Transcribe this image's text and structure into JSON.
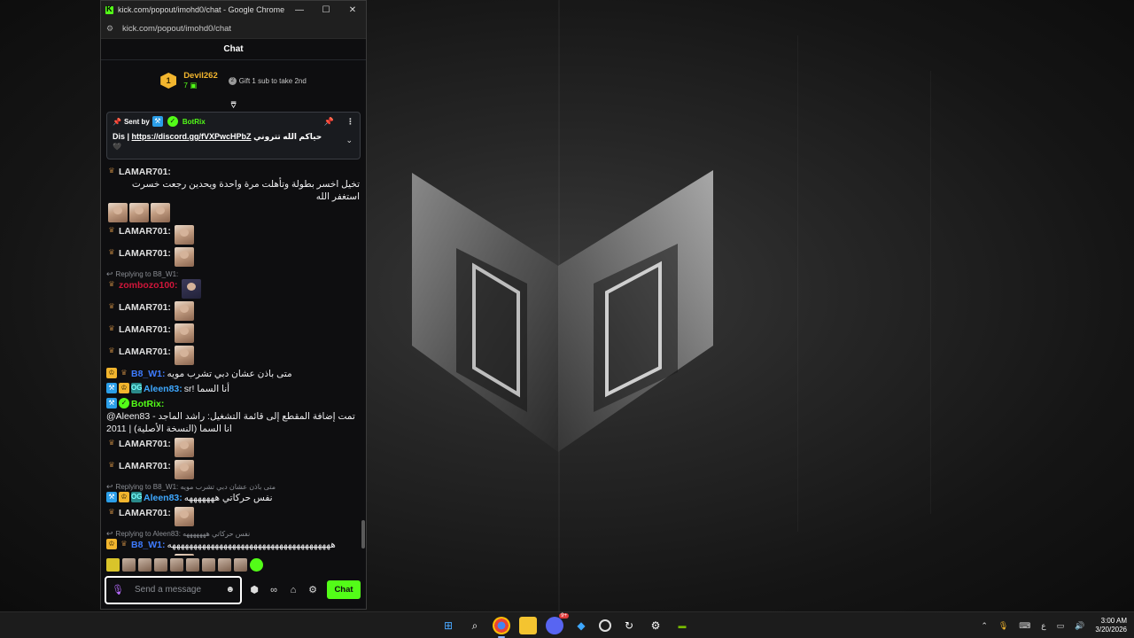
{
  "browser": {
    "title": "kick.com/popout/imohd0/chat - Google Chrome",
    "url": "kick.com/popout/imohd0/chat",
    "minimize": "—",
    "maximize": "☐",
    "close": "✕"
  },
  "chat": {
    "header": "Chat",
    "leaderboard": {
      "rank": "1",
      "username": "Devil262",
      "count": "7",
      "gift_text": "Gift 1 sub to take 2nd",
      "toggle": "⩢"
    },
    "pinned": {
      "sent_by_label": "Sent by",
      "sender": "BotRix",
      "message_prefix": "Dis |",
      "message_link": "https://discord.gg/fVXPwcHPbZ",
      "message_suffix": "حياكم الله تتروني",
      "message_line2": "🖤"
    },
    "messages": [
      {
        "type": "msg",
        "user": "LAMAR701",
        "style": "lamar",
        "badges": [
          "tier"
        ],
        "text": "تخيل اخسر بطولة وتأهلت مرة واحدة ويحدين رجعت خسرت استغفر الله",
        "emotes": 3
      },
      {
        "type": "msg",
        "user": "LAMAR701",
        "style": "lamar",
        "badges": [
          "tier"
        ],
        "text": "",
        "emotes": 1
      },
      {
        "type": "msg",
        "user": "LAMAR701",
        "style": "lamar",
        "badges": [
          "tier"
        ],
        "text": "",
        "emotes": 1
      },
      {
        "type": "reply",
        "text": "Replying to B8_W1:"
      },
      {
        "type": "msg",
        "user": "zombozo100",
        "style": "zombozo",
        "badges": [
          "tier"
        ],
        "text": "",
        "emotes": 1,
        "dark": true
      },
      {
        "type": "msg",
        "user": "LAMAR701",
        "style": "lamar",
        "badges": [
          "tier"
        ],
        "text": "",
        "emotes": 1
      },
      {
        "type": "msg",
        "user": "LAMAR701",
        "style": "lamar",
        "badges": [
          "tier"
        ],
        "text": "",
        "emotes": 1
      },
      {
        "type": "msg",
        "user": "LAMAR701",
        "style": "lamar",
        "badges": [
          "tier"
        ],
        "text": "",
        "emotes": 1
      },
      {
        "type": "msg",
        "user": "B8_W1",
        "style": "b8",
        "badges": [
          "crown",
          "tier"
        ],
        "text": "متى باذن عشان دبي تشرب مويه",
        "emotes": 0
      },
      {
        "type": "msg",
        "user": "Aleen83",
        "style": "aleen",
        "badges": [
          "mod",
          "crown",
          "og"
        ],
        "text": "أنا السما !sr",
        "emotes": 0
      },
      {
        "type": "msg",
        "user": "BotRix",
        "style": "botrix",
        "badges": [
          "mod",
          "verified"
        ],
        "text": "@Aleen83 تمت إضافة المقطع إلى قائمة التشغيل: راشد الماجد - انا السما (النسخة الأصلية) | 2011",
        "emotes": 0
      },
      {
        "type": "msg",
        "user": "LAMAR701",
        "style": "lamar",
        "badges": [
          "tier"
        ],
        "text": "",
        "emotes": 1
      },
      {
        "type": "msg",
        "user": "LAMAR701",
        "style": "lamar",
        "badges": [
          "tier"
        ],
        "text": "",
        "emotes": 1
      },
      {
        "type": "reply",
        "text": "Replying to B8_W1: متى باذن عشان دبي تشرب مويه"
      },
      {
        "type": "msg",
        "user": "Aleen83",
        "style": "aleen",
        "badges": [
          "mod",
          "crown",
          "og"
        ],
        "text": "نفس حركاتي هههههههه",
        "emotes": 0
      },
      {
        "type": "msg",
        "user": "LAMAR701",
        "style": "lamar",
        "badges": [
          "tier"
        ],
        "text": "",
        "emotes": 1
      },
      {
        "type": "reply",
        "text": "Replying to Aleen83: نفس حركاتي هههههههه"
      },
      {
        "type": "msg",
        "user": "B8_W1",
        "style": "b8",
        "badges": [
          "crown",
          "tier"
        ],
        "text": "ههههههههههههههههههههههههههههههههههههههه",
        "emotes": 0
      },
      {
        "type": "msg",
        "user": "LAMAR701",
        "style": "lamar",
        "badges": [
          "tier"
        ],
        "text": "",
        "emotes": 1
      }
    ],
    "input": {
      "placeholder": "Send a message",
      "send_label": "Chat"
    }
  },
  "taskbar": {
    "apps": [
      "windows-start",
      "search",
      "chrome",
      "file-explorer",
      "discord",
      "vscode",
      "obs",
      "steam-helper",
      "settings",
      "nvidia"
    ],
    "discord_badge": "9+",
    "tray_lang": "ع",
    "time": "3:00 AM",
    "date": "3/20/2026"
  },
  "colors": {
    "kick_green": "#53fc18",
    "gold": "#f2b52e",
    "zombozo": "#d0163a",
    "b8": "#3e7bff",
    "aleen": "#3ea8ff"
  }
}
